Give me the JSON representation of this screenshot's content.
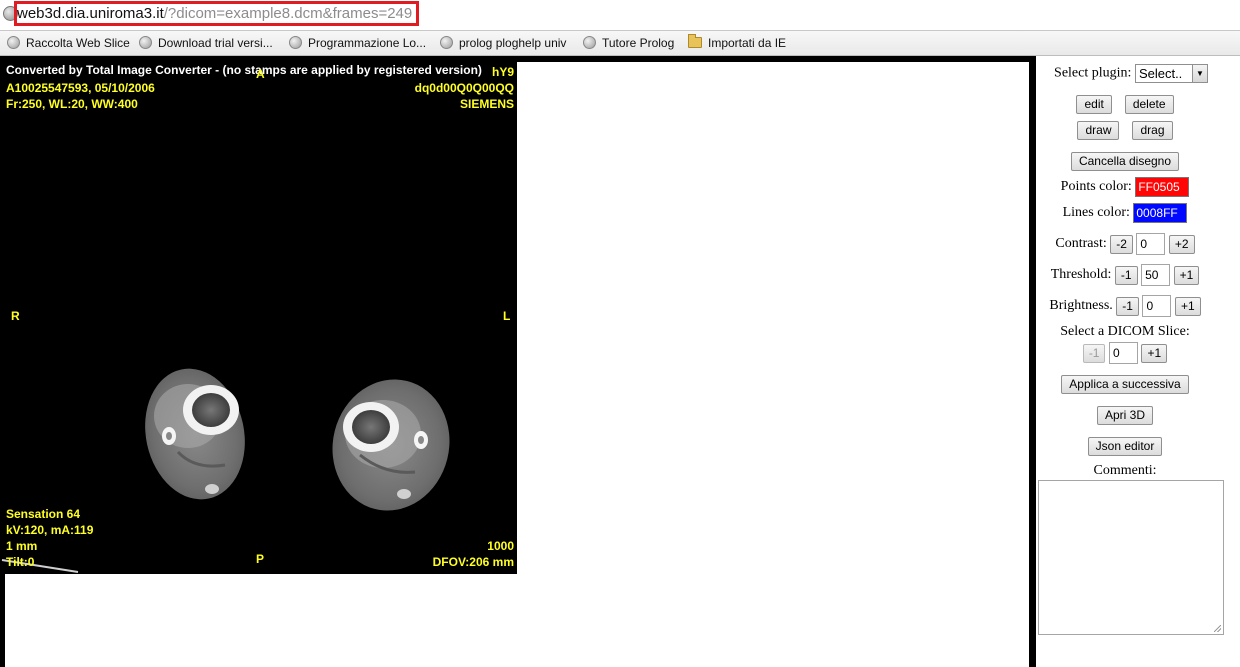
{
  "browser": {
    "address_domain": "web3d.dia.uniroma3.it",
    "address_path": "/?dicom=example8.dcm&frames=249",
    "bookmarks": [
      {
        "label": "Raccolta Web Slice",
        "icon": "globe-icon"
      },
      {
        "label": "Download trial versi...",
        "icon": "globe-icon"
      },
      {
        "label": "Programmazione Lo...",
        "icon": "globe-icon"
      },
      {
        "label": "prolog ploghelp univ",
        "icon": "globe-icon"
      },
      {
        "label": "Tutore Prolog",
        "icon": "globe-icon"
      },
      {
        "label": "Importati da IE",
        "icon": "folder-icon"
      }
    ],
    "highlight_color": "#e01b22"
  },
  "dicom": {
    "banner": "Converted by Total Image Converter - (no stamps are applied by registered version)",
    "top_left": [
      "A10025547593, 05/10/2006",
      "Fr:250, WL:20, WW:400"
    ],
    "top_right": [
      "hY9",
      "dq0d00Q0Q00QQ",
      "SIEMENS"
    ],
    "orient_top": "A",
    "orient_left": "R",
    "orient_right": "L",
    "orient_bottom": "P",
    "bottom_left": [
      "Sensation 64",
      "kV:120, mA:119",
      "1 mm",
      "Tilt:0"
    ],
    "bottom_right": [
      "1000",
      "DFOV:206 mm"
    ],
    "overlay_color": "#ffff22"
  },
  "panel": {
    "select_plugin_label": "Select plugin:",
    "select_plugin_value": "Select..",
    "edit_label": "edit",
    "delete_label": "delete",
    "draw_label": "draw",
    "drag_label": "drag",
    "clear_drawing_label": "Cancella disegno",
    "points_color_label": "Points color:",
    "points_color_value": "FF0505",
    "points_color": "#ff0505",
    "lines_color_label": "Lines color:",
    "lines_color_value": "0008FF",
    "lines_color": "#0008ff",
    "contrast_label": "Contrast:",
    "contrast_minus": "-2",
    "contrast_value": "0",
    "contrast_plus": "+2",
    "threshold_label": "Threshold:",
    "threshold_minus": "-1",
    "threshold_value": "50",
    "threshold_plus": "+1",
    "brightness_label": "Brightness.",
    "brightness_minus": "-1",
    "brightness_value": "0",
    "brightness_plus": "+1",
    "slice_label": "Select a DICOM Slice:",
    "slice_minus": "-1",
    "slice_value": "0",
    "slice_plus": "+1",
    "apply_next_label": "Applica a successiva",
    "open_3d_label": "Apri 3D",
    "json_editor_label": "Json editor",
    "comments_label": "Commenti:",
    "comments_value": ""
  }
}
